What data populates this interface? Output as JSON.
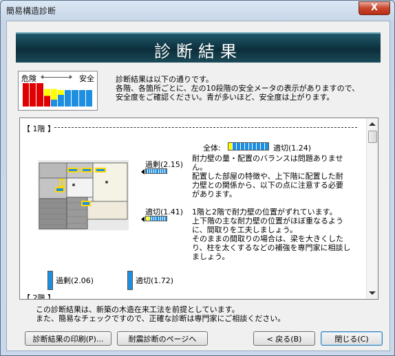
{
  "window": {
    "title": "簡易構造診断",
    "close_glyph": "X"
  },
  "banner": {
    "title": "診断結果"
  },
  "legend": {
    "danger": "危険",
    "safe": "安全"
  },
  "description": {
    "line1": "診断結果は以下の通りです。",
    "line2": "各階、各箇所ごとに、左の10段階の安全メータの表示がありますので、",
    "line3": "安全度をご確認ください。青が多いほど、安全度は上がります。"
  },
  "floor1": {
    "header": "【 1階 】",
    "overall_label": "全体:",
    "overall_rating": "適切(1.24)",
    "top_rating": "過剰(2.15)",
    "mid_rating": "適切(1.41)",
    "bottom_left_rating": "過剰(2.06)",
    "bottom_right_rating": "適切(1.72)",
    "advice": [
      "耐力壁の量・配置のバランスは問題ありませ",
      "ん。",
      "配置した部屋の特徴や、上下階に配置した耐",
      "力壁との関係から、以下の点に注意する必要",
      "があります。",
      "",
      "1階と2階で耐力壁の位置がずれています。",
      " 上下階の主な耐力壁の位置がほぼ重なるよう",
      "に、間取りを工夫しましょう。",
      " そのままの間取りの場合は、梁を大きくした",
      "り、柱を太くするなどの補強を専門家に相談し",
      "ましょう。"
    ]
  },
  "floor2": {
    "header": "【 2階 】"
  },
  "footer": {
    "line1": "この診断結果は、新築の木造在来工法を前提としています。",
    "line2": "また、簡易なチェックですので、正確な診断は専門家にご相談ください。"
  },
  "buttons": {
    "print": "診断結果の印刷(P)...",
    "seismic": "耐震診断のページへ",
    "back": "< 戻る(B)",
    "close": "閉じる(C)"
  },
  "colors": {
    "red": "#e10000",
    "yellow": "#ffff00",
    "blue": "#1e8fe0",
    "white": "#ffffff"
  },
  "meters": {
    "overall": {
      "red": 0,
      "yellow": 1,
      "blue": 9
    },
    "top": {
      "red": 0,
      "yellow": 0,
      "blue": 10
    },
    "mid": {
      "red": 0,
      "yellow": 2,
      "blue": 8
    },
    "bottom_left": {
      "red": 0,
      "yellow": 0,
      "blue": 10
    },
    "bottom_right": {
      "red": 0,
      "yellow": 0,
      "blue": 10
    }
  }
}
